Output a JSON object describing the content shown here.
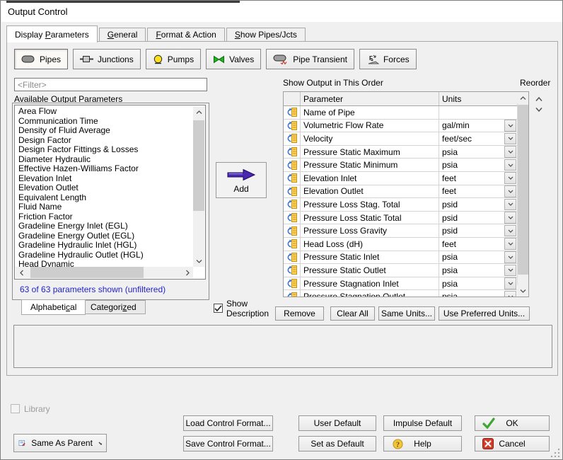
{
  "window": {
    "title": "Output Control"
  },
  "tabs": [
    {
      "pre": "Display ",
      "key": "P",
      "post": "arameters"
    },
    {
      "pre": "",
      "key": "G",
      "post": "eneral"
    },
    {
      "pre": "",
      "key": "F",
      "post": "ormat & Action"
    },
    {
      "pre": "",
      "key": "S",
      "post": "how Pipes/Jcts"
    }
  ],
  "toolbar": {
    "items": [
      {
        "label": "Pipes"
      },
      {
        "label": "Junctions"
      },
      {
        "label": "Pumps"
      },
      {
        "label": "Valves"
      },
      {
        "label": "Pipe Transient"
      },
      {
        "label": "Forces"
      }
    ]
  },
  "left": {
    "filter_placeholder": "<Filter>",
    "label": "Available Output Parameters",
    "items": [
      "Area Flow",
      "Communication Time",
      "Density of Fluid Average",
      "Design Factor",
      "Design Factor Fittings & Losses",
      "Diameter Hydraulic",
      "Effective Hazen-Williams Factor",
      "Elevation Inlet",
      "Elevation Outlet",
      "Equivalent Length",
      "Fluid Name",
      "Friction Factor",
      "Gradeline Energy Inlet (EGL)",
      "Gradeline Energy Outlet (EGL)",
      "Gradeline Hydraulic Inlet (HGL)",
      "Gradeline Hydraulic Outlet (HGL)",
      "Head Dynamic"
    ],
    "count_text": "63 of 63 parameters shown (unfiltered)",
    "bottom_tabs": [
      {
        "pre": "Alphabeti",
        "key": "c",
        "post": "al"
      },
      {
        "pre": "Categori",
        "key": "z",
        "post": "ed"
      }
    ]
  },
  "add": {
    "label": "Add"
  },
  "show_description": {
    "line1": "Show",
    "line2": "Description",
    "checked": true
  },
  "output": {
    "title": "Show Output in This Order",
    "reorder_label": "Reorder",
    "columns": {
      "parameter": "Parameter",
      "units": "Units"
    },
    "rows": [
      {
        "param": "Name of Pipe",
        "units": "",
        "has_dropdown": false
      },
      {
        "param": "Volumetric Flow Rate",
        "units": "gal/min",
        "has_dropdown": true
      },
      {
        "param": "Velocity",
        "units": "feet/sec",
        "has_dropdown": true
      },
      {
        "param": "Pressure Static Maximum",
        "units": "psia",
        "has_dropdown": true
      },
      {
        "param": "Pressure Static Minimum",
        "units": "psia",
        "has_dropdown": true
      },
      {
        "param": "Elevation Inlet",
        "units": "feet",
        "has_dropdown": true
      },
      {
        "param": "Elevation Outlet",
        "units": "feet",
        "has_dropdown": true
      },
      {
        "param": "Pressure Loss Stag. Total",
        "units": "psid",
        "has_dropdown": true
      },
      {
        "param": "Pressure Loss Static Total",
        "units": "psid",
        "has_dropdown": true
      },
      {
        "param": "Pressure Loss Gravity",
        "units": "psid",
        "has_dropdown": true
      },
      {
        "param": "Head Loss (dH)",
        "units": "feet",
        "has_dropdown": true
      },
      {
        "param": "Pressure Static Inlet",
        "units": "psia",
        "has_dropdown": true
      },
      {
        "param": "Pressure Static Outlet",
        "units": "psia",
        "has_dropdown": true
      },
      {
        "param": "Pressure Stagnation Inlet",
        "units": "psia",
        "has_dropdown": true
      },
      {
        "param": "Pressure Stagnation Outlet",
        "units": "psia",
        "has_dropdown": true
      }
    ],
    "actions": {
      "remove": "Remove",
      "clear_all": "Clear All",
      "same_units": "Same Units...",
      "use_preferred": "Use Preferred Units..."
    }
  },
  "bottom": {
    "library_label": "Library",
    "same_as_parent": "Same As Parent",
    "load_format": "Load Control Format...",
    "save_format": "Save Control Format...",
    "user_default": "User Default",
    "impulse_default": "Impulse Default",
    "set_as_default": "Set as Default",
    "help": "Help",
    "ok": "OK",
    "cancel": "Cancel"
  },
  "colors": {
    "link_blue": "#2222cc",
    "add_arrow_purple": "#4a28b0",
    "ok_green": "#3fa535",
    "cancel_red": "#d23b29",
    "help_gold": "#f3c63a",
    "pump_yellow": "#ffe11a",
    "valve_green": "#1db31d",
    "transient_red": "#d03a2a",
    "row_icon_blue": "#2f6fce",
    "row_icon_yellow": "#ffd75e"
  }
}
